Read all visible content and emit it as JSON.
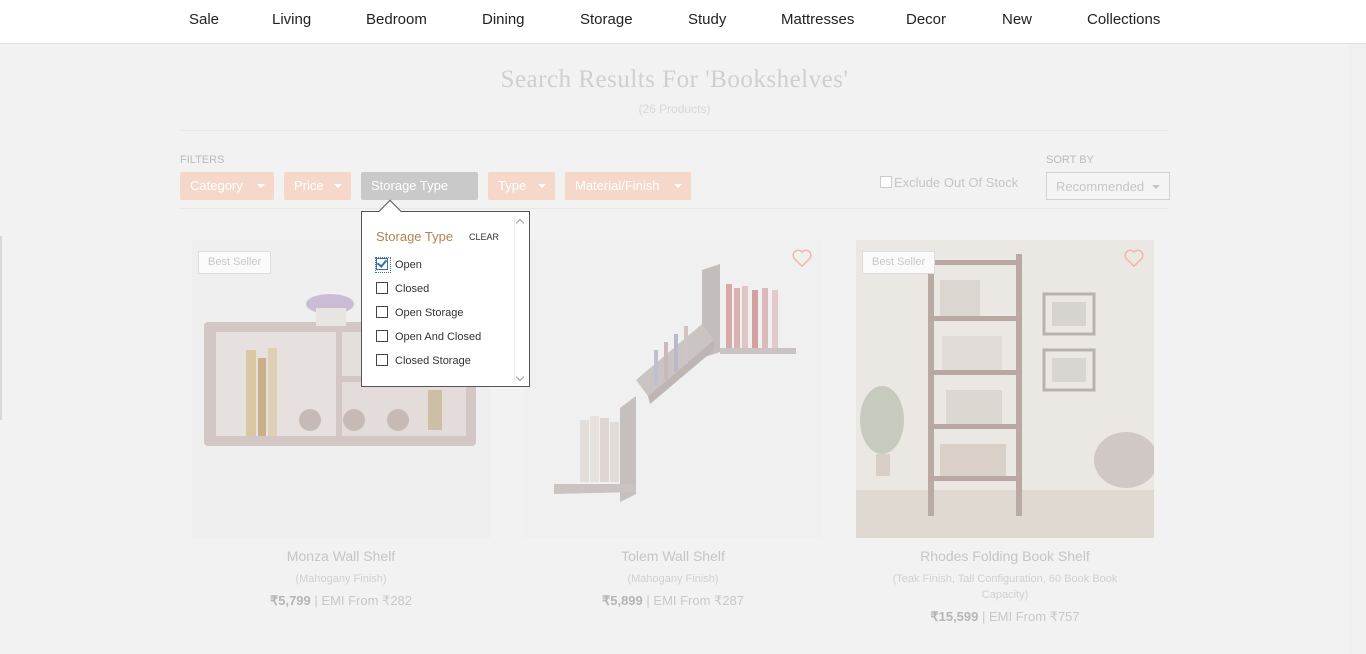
{
  "nav": {
    "items": [
      "Sale",
      "Living",
      "Bedroom",
      "Dining",
      "Storage",
      "Study",
      "Mattresses",
      "Decor",
      "New",
      "Collections"
    ]
  },
  "search": {
    "title": "Search Results For 'Bookshelves'",
    "count": "(26 Products)"
  },
  "filters": {
    "label": "FILTERS",
    "chips": [
      "Category",
      "Price",
      "Storage Type",
      "Type",
      "Material/Finish"
    ],
    "active_chip": "Storage Type",
    "exclude_label": "Exclude Out Of Stock"
  },
  "sort": {
    "label": "SORT BY",
    "value": "Recommended"
  },
  "dropdown": {
    "title": "Storage Type",
    "clear": "CLEAR",
    "options": [
      {
        "label": "Open",
        "checked": true
      },
      {
        "label": "Closed",
        "checked": false
      },
      {
        "label": "Open Storage",
        "checked": false
      },
      {
        "label": "Open And Closed",
        "checked": false
      },
      {
        "label": "Closed Storage",
        "checked": false
      }
    ]
  },
  "products": [
    {
      "name": "Monza Wall Shelf",
      "finish": "(Mahogany Finish)",
      "price": "₹5,799",
      "emi": "| EMI From ₹282",
      "badge": "Best Seller",
      "wishlist": false
    },
    {
      "name": "Tolem Wall Shelf",
      "finish": "(Mahogany Finish)",
      "price": "₹5,899",
      "emi": "| EMI From ₹287",
      "badge": "",
      "wishlist": true
    },
    {
      "name": "Rhodes Folding Book Shelf",
      "finish": "(Teak Finish, Tall Configuration, 60 Book Book Capacity)",
      "price": "₹15,599",
      "emi": "| EMI From ₹757",
      "badge": "Best Seller",
      "wishlist": true
    }
  ],
  "colors": {
    "accent": "#b5824f",
    "chip": "#f5d8c9",
    "heart": "#f3b6a8"
  }
}
